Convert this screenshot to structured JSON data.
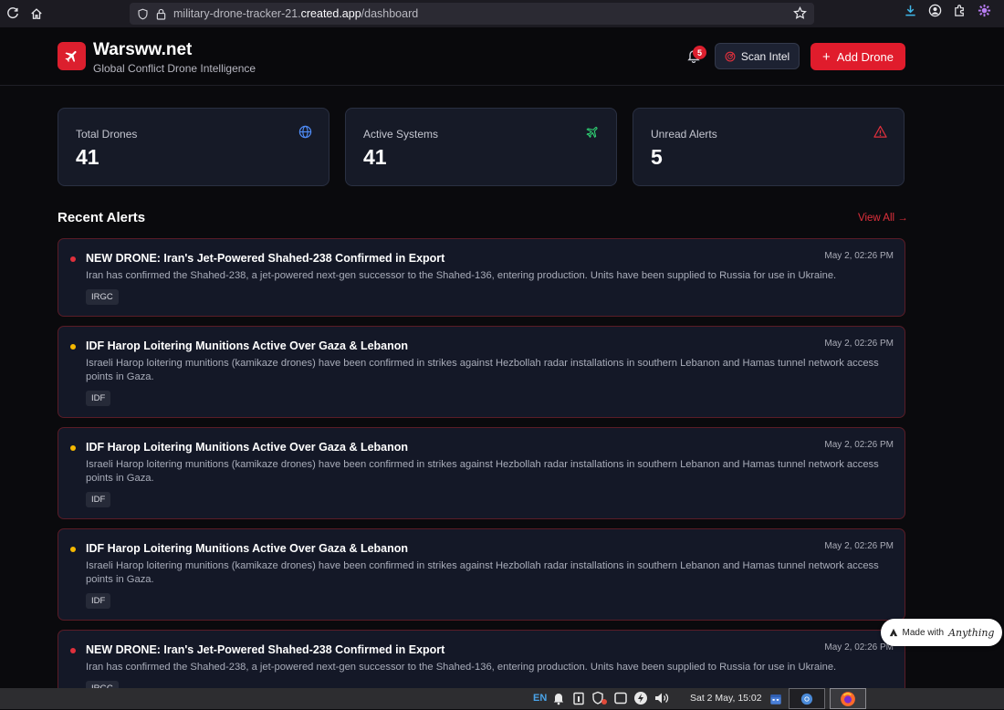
{
  "browser": {
    "url_prefix": "military-drone-tracker-21.",
    "url_host": "created.app",
    "url_path": "/dashboard"
  },
  "header": {
    "brand_title": "Warsww.net",
    "brand_subtitle": "Global Conflict Drone Intelligence",
    "notification_count": "5",
    "scan_label": "Scan Intel",
    "add_label": "Add Drone"
  },
  "stats": [
    {
      "label": "Total Drones",
      "value": "41",
      "icon": "globe-icon",
      "color": "#4f8cf7"
    },
    {
      "label": "Active Systems",
      "value": "41",
      "icon": "plane-icon",
      "color": "#2ecc71"
    },
    {
      "label": "Unread Alerts",
      "value": "5",
      "icon": "warning-icon",
      "color": "#e0303c"
    }
  ],
  "alerts_section": {
    "title": "Recent Alerts",
    "view_all": "View All →"
  },
  "alerts": [
    {
      "title": "NEW DRONE: Iran's Jet-Powered Shahed-238 Confirmed in Export",
      "time": "May 2, 02:26 PM",
      "desc": "Iran has confirmed the Shahed-238, a jet-powered next-gen successor to the Shahed-136, entering production. Units have been supplied to Russia for use in Ukraine.",
      "tag": "IRGC",
      "dot_color": "#e0303c"
    },
    {
      "title": "IDF Harop Loitering Munitions Active Over Gaza & Lebanon",
      "time": "May 2, 02:26 PM",
      "desc": "Israeli Harop loitering munitions (kamikaze drones) have been confirmed in strikes against Hezbollah radar installations in southern Lebanon and Hamas tunnel network access points in Gaza.",
      "tag": "IDF",
      "dot_color": "#f5b800"
    },
    {
      "title": "IDF Harop Loitering Munitions Active Over Gaza & Lebanon",
      "time": "May 2, 02:26 PM",
      "desc": "Israeli Harop loitering munitions (kamikaze drones) have been confirmed in strikes against Hezbollah radar installations in southern Lebanon and Hamas tunnel network access points in Gaza.",
      "tag": "IDF",
      "dot_color": "#f5b800"
    },
    {
      "title": "IDF Harop Loitering Munitions Active Over Gaza & Lebanon",
      "time": "May 2, 02:26 PM",
      "desc": "Israeli Harop loitering munitions (kamikaze drones) have been confirmed in strikes against Hezbollah radar installations in southern Lebanon and Hamas tunnel network access points in Gaza.",
      "tag": "IDF",
      "dot_color": "#f5b800"
    },
    {
      "title": "NEW DRONE: Iran's Jet-Powered Shahed-238 Confirmed in Export",
      "time": "May 2, 02:26 PM",
      "desc": "Iran has confirmed the Shahed-238, a jet-powered next-gen successor to the Shahed-136, entering production. Units have been supplied to Russia for use in Ukraine.",
      "tag": "IRGC",
      "dot_color": "#e0303c"
    }
  ],
  "badge": {
    "made_with": "Made with",
    "brand": "Anything"
  },
  "taskbar": {
    "lang": "EN",
    "clock": "Sat  2 May, 15:02"
  }
}
